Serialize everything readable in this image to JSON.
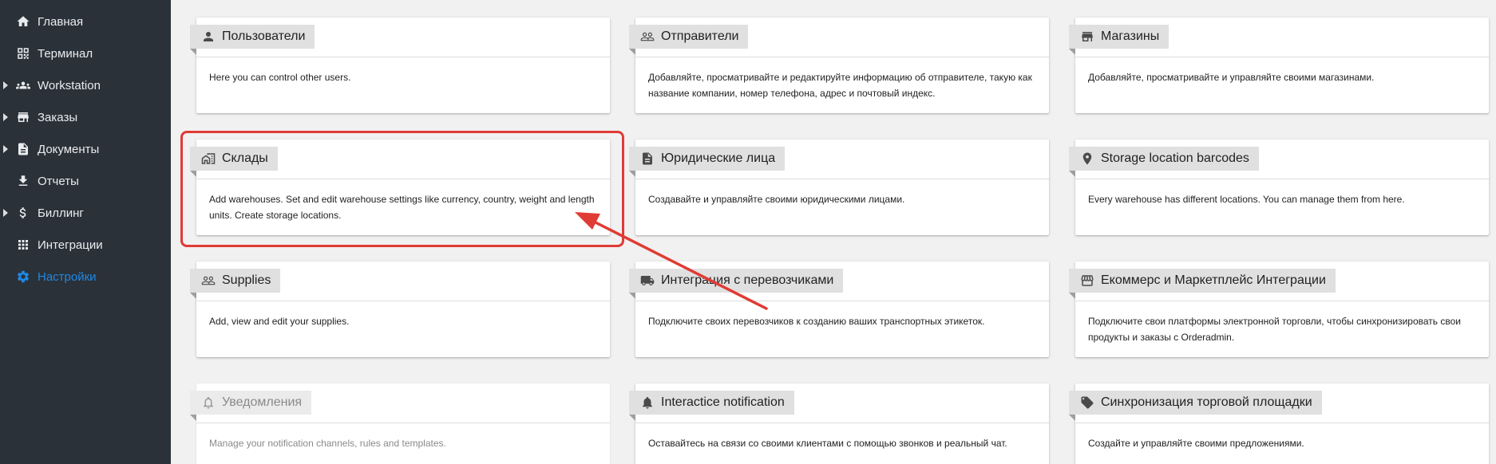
{
  "sidebar": {
    "items": [
      {
        "label": "Главная",
        "icon": "home-icon",
        "expandable": false,
        "active": false
      },
      {
        "label": "Терминал",
        "icon": "qr-code-icon",
        "expandable": false,
        "active": false
      },
      {
        "label": "Workstation",
        "icon": "group-icon",
        "expandable": true,
        "active": false
      },
      {
        "label": "Заказы",
        "icon": "store-icon",
        "expandable": true,
        "active": false
      },
      {
        "label": "Документы",
        "icon": "document-icon",
        "expandable": true,
        "active": false
      },
      {
        "label": "Отчеты",
        "icon": "download-icon",
        "expandable": false,
        "active": false
      },
      {
        "label": "Биллинг",
        "icon": "dollar-icon",
        "expandable": true,
        "active": false
      },
      {
        "label": "Интеграции",
        "icon": "apps-grid-icon",
        "expandable": false,
        "active": false
      },
      {
        "label": "Настройки",
        "icon": "gear-icon",
        "expandable": false,
        "active": true
      }
    ]
  },
  "cards": [
    {
      "title": "Пользователи",
      "icon": "person-icon",
      "text": "Here you can control other users."
    },
    {
      "title": "Отправители",
      "icon": "people-outline-icon",
      "text": "Добавляйте, просматривайте и редактируйте информацию об отправителе, такую как название компании, номер телефона, адрес и почтовый индекс."
    },
    {
      "title": "Магазины",
      "icon": "store-icon",
      "text": "Добавляйте, просматривайте и управляйте своими магазинами."
    },
    {
      "title": "Склады",
      "icon": "warehouse-icon",
      "text": "Add warehouses. Set and edit warehouse settings like currency, country, weight and length units. Create storage locations."
    },
    {
      "title": "Юридические лица",
      "icon": "document-icon",
      "text": "Создавайте и управляйте своими юридическими лицами."
    },
    {
      "title": "Storage location barcodes",
      "icon": "location-pin-icon",
      "text": "Every warehouse has different locations. You can manage them from here."
    },
    {
      "title": "Supplies",
      "icon": "people-outline-icon",
      "text": "Add, view and edit your supplies."
    },
    {
      "title": "Интеграция с перевозчиками",
      "icon": "truck-icon",
      "text": "Подключите своих перевозчиков к созданию ваших транспортных этикеток."
    },
    {
      "title": "Екоммерс и Маркетплейс Интеграции",
      "icon": "storefront-icon",
      "text": "Подключите свои платформы электронной торговли, чтобы синхронизировать свои продукты и заказы с Orderadmin."
    },
    {
      "title": "Уведомления",
      "icon": "bell-outline-icon",
      "text": "Manage your notification channels, rules and templates.",
      "disabled": true
    },
    {
      "title": "Interactice notification",
      "icon": "bell-icon",
      "text": "Оставайтесь на связи со своими клиентами с помощью звонков и реальный чат."
    },
    {
      "title": "Синхронизация торговой площадки",
      "icon": "tag-icon",
      "text": "Создайте и управляйте своими предложениями."
    }
  ],
  "colors": {
    "sidebar_bg": "#2b3138",
    "active": "#1e88e5",
    "annotation": "#e03b35",
    "content_bg": "#f1f1f1"
  }
}
